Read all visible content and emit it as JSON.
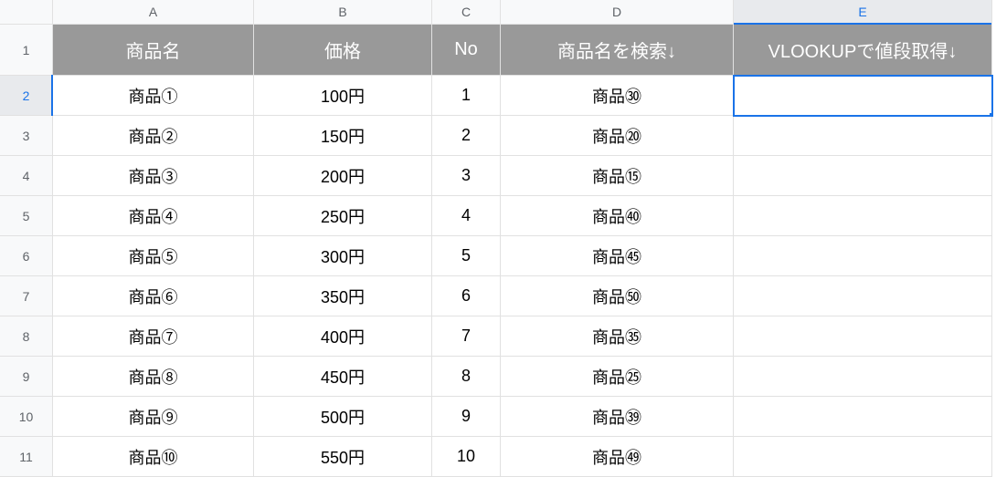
{
  "columns": [
    "A",
    "B",
    "C",
    "D",
    "E"
  ],
  "rowNumbers": [
    "1",
    "2",
    "3",
    "4",
    "5",
    "6",
    "7",
    "8",
    "9",
    "10",
    "11"
  ],
  "headerRow": {
    "A": "商品名",
    "B": "価格",
    "C": "No",
    "D": "商品名を検索↓",
    "E": "VLOOKUPで値段取得↓"
  },
  "rows": [
    {
      "A": "商品①",
      "B": "100円",
      "C": "1",
      "D": "商品㉚",
      "E": ""
    },
    {
      "A": "商品②",
      "B": "150円",
      "C": "2",
      "D": "商品⑳",
      "E": ""
    },
    {
      "A": "商品③",
      "B": "200円",
      "C": "3",
      "D": "商品⑮",
      "E": ""
    },
    {
      "A": "商品④",
      "B": "250円",
      "C": "4",
      "D": "商品㊵",
      "E": ""
    },
    {
      "A": "商品⑤",
      "B": "300円",
      "C": "5",
      "D": "商品㊺",
      "E": ""
    },
    {
      "A": "商品⑥",
      "B": "350円",
      "C": "6",
      "D": "商品㊿",
      "E": ""
    },
    {
      "A": "商品⑦",
      "B": "400円",
      "C": "7",
      "D": "商品㉟",
      "E": ""
    },
    {
      "A": "商品⑧",
      "B": "450円",
      "C": "8",
      "D": "商品㉕",
      "E": ""
    },
    {
      "A": "商品⑨",
      "B": "500円",
      "C": "9",
      "D": "商品㊴",
      "E": ""
    },
    {
      "A": "商品⑩",
      "B": "550円",
      "C": "10",
      "D": "商品㊾",
      "E": ""
    }
  ],
  "activeCell": {
    "row": 2,
    "col": "E"
  }
}
